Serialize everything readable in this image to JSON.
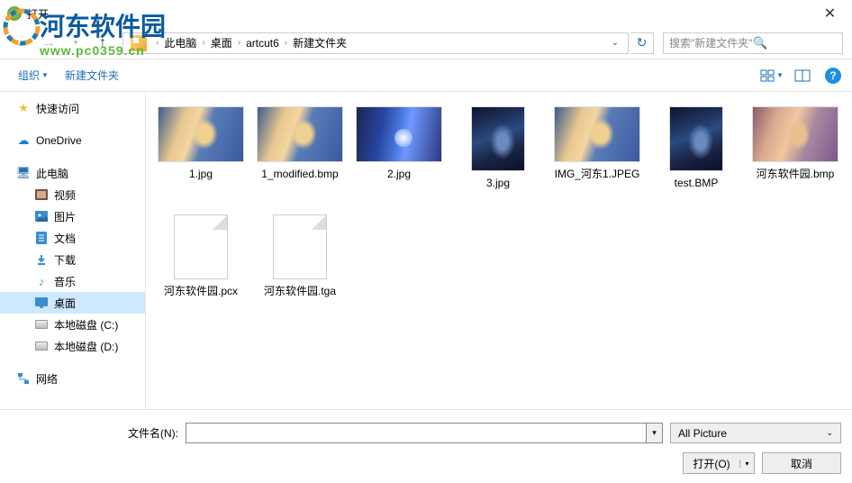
{
  "window": {
    "title": "打开"
  },
  "watermark": {
    "text": "河东软件园",
    "url": "www.pc0359.cn"
  },
  "nav": {
    "crumbs": [
      "此电脑",
      "桌面",
      "artcut6",
      "新建文件夹"
    ],
    "search_placeholder": "搜索\"新建文件夹\""
  },
  "toolbar": {
    "organize": "组织",
    "newfolder": "新建文件夹"
  },
  "sidebar": {
    "quick": "快速访问",
    "onedrive": "OneDrive",
    "pc": "此电脑",
    "video": "视频",
    "pictures": "图片",
    "docs": "文档",
    "downloads": "下载",
    "music": "音乐",
    "desktop": "桌面",
    "drivec": "本地磁盘 (C:)",
    "drived": "本地磁盘 (D:)",
    "network": "网络"
  },
  "files": [
    {
      "name": "1.jpg",
      "art": "art-anime1",
      "shape": "wide"
    },
    {
      "name": "1_modified.bmp",
      "art": "art-anime1",
      "shape": "wide"
    },
    {
      "name": "2.jpg",
      "art": "art-blue",
      "shape": "wide"
    },
    {
      "name": "3.jpg",
      "art": "art-dark",
      "shape": "tall"
    },
    {
      "name": "IMG_河东1.JPEG",
      "art": "art-anime1",
      "shape": "wide"
    },
    {
      "name": "test.BMP",
      "art": "art-dark",
      "shape": "tall"
    },
    {
      "name": "河东软件园.bmp",
      "art": "art-pink",
      "shape": "wide"
    },
    {
      "name": "河东软件园.pcx",
      "art": "file",
      "shape": "file"
    },
    {
      "name": "河东软件园.tga",
      "art": "file",
      "shape": "file"
    }
  ],
  "bottom": {
    "filename_label": "文件名(N):",
    "filter": "All Picture",
    "open": "打开(O)",
    "cancel": "取消"
  }
}
